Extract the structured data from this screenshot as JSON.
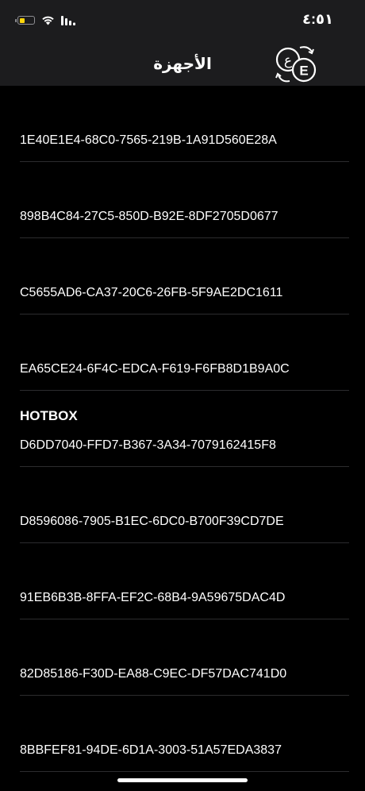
{
  "status_bar": {
    "time": "٤:٥١",
    "battery_level": 0.4,
    "battery_color": "#ffd60a"
  },
  "nav": {
    "title": "الأجهزة",
    "language_button_icon": "language-switch-icon"
  },
  "devices": [
    {
      "name": "",
      "uuid": "1E40E1E4-68C0-7565-219B-1A91D560E28A"
    },
    {
      "name": "",
      "uuid": "898B4C84-27C5-850D-B92E-8DF2705D0677"
    },
    {
      "name": "",
      "uuid": "C5655AD6-CA37-20C6-26FB-5F9AE2DC1611"
    },
    {
      "name": "",
      "uuid": "EA65CE24-6F4C-EDCA-F619-F6FB8D1B9A0C"
    },
    {
      "name": "HOTBOX",
      "uuid": "D6DD7040-FFD7-B367-3A34-7079162415F8"
    },
    {
      "name": "",
      "uuid": "D8596086-7905-B1EC-6DC0-B700F39CD7DE"
    },
    {
      "name": "",
      "uuid": "91EB6B3B-8FFA-EF2C-68B4-9A59675DAC4D"
    },
    {
      "name": "",
      "uuid": "82D85186-F30D-EA88-C9EC-DF57DAC741D0"
    },
    {
      "name": "",
      "uuid": "8BBFEF81-94DE-6D1A-3003-51A57EDA3837"
    }
  ]
}
